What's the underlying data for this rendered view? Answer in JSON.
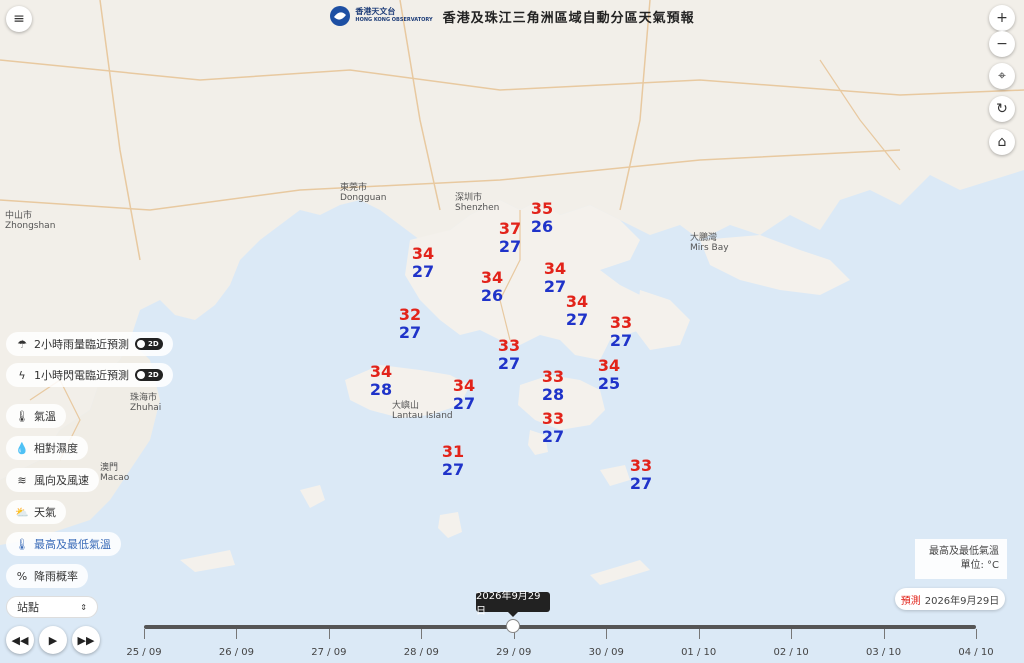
{
  "header": {
    "logo_text_zh": "香港天文台",
    "logo_text_en": "HONG KONG OBSERVATORY",
    "title": "香港及珠江三角洲區域自動分區天氣預報"
  },
  "map_labels": [
    {
      "text": "深圳市",
      "sub": "Shenzhen"
    },
    {
      "text": "中山市",
      "sub": "Zhongshan"
    },
    {
      "text": "大鵬灣",
      "sub": "Mirs Bay"
    },
    {
      "text": "珠海市",
      "sub": "Zhuhai"
    },
    {
      "text": "澳門",
      "sub": "Macao"
    },
    {
      "text": "大嶼山",
      "sub": "Lantau Island"
    },
    {
      "text": "東莞市",
      "sub": "Dongguan"
    }
  ],
  "layers": [
    {
      "label": "2小時雨量臨近預測",
      "icon": "rain-cloud-icon",
      "toggle": "2D"
    },
    {
      "label": "1小時閃電臨近預測",
      "icon": "lightning-icon",
      "toggle": "2D"
    },
    {
      "label": "氣溫",
      "icon": "thermometer-icon"
    },
    {
      "label": "相對濕度",
      "icon": "droplet-icon"
    },
    {
      "label": "風向及風速",
      "icon": "wind-icon"
    },
    {
      "label": "天氣",
      "icon": "weather-icon"
    },
    {
      "label": "最高及最低氣溫",
      "icon": "max-min-temp-icon"
    },
    {
      "label": "降雨概率",
      "icon": "percent-icon"
    }
  ],
  "station_select": {
    "value": "站點"
  },
  "temperatures": [
    {
      "hi": "35",
      "lo": "26"
    },
    {
      "hi": "37",
      "lo": "27"
    },
    {
      "hi": "34",
      "lo": "27"
    },
    {
      "hi": "34",
      "lo": "26"
    },
    {
      "hi": "34",
      "lo": "27"
    },
    {
      "hi": "34",
      "lo": "27"
    },
    {
      "hi": "32",
      "lo": "27"
    },
    {
      "hi": "33",
      "lo": "27"
    },
    {
      "hi": "33",
      "lo": "27"
    },
    {
      "hi": "34",
      "lo": "25"
    },
    {
      "hi": "33",
      "lo": "28"
    },
    {
      "hi": "34",
      "lo": "28"
    },
    {
      "hi": "34",
      "lo": "27"
    },
    {
      "hi": "33",
      "lo": "27"
    },
    {
      "hi": "31",
      "lo": "27"
    },
    {
      "hi": "33",
      "lo": "27"
    }
  ],
  "legend": {
    "line1": "最高及最低氣溫",
    "line2": "單位: °C"
  },
  "forecast": {
    "flag": "預測",
    "date": "2026年9月29日"
  },
  "timeline": {
    "dates": [
      "25 / 09",
      "26 / 09",
      "27 / 09",
      "28 / 09",
      "29 / 09",
      "30 / 09",
      "01 / 10",
      "02 / 10",
      "03 / 10",
      "04 / 10"
    ],
    "current_tooltip": "2026年9月29日",
    "current_index": 4
  },
  "colors": {
    "max_temp": "#e2231a",
    "min_temp": "#1f33c9",
    "sea": "#dbe9f6",
    "land": "#f2efe9"
  }
}
